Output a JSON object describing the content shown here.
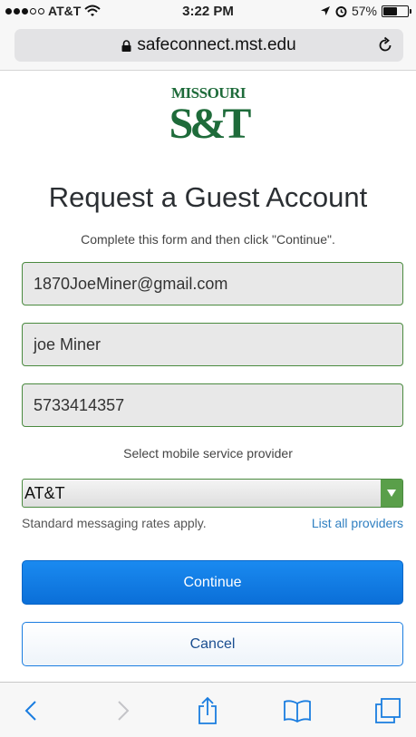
{
  "status_bar": {
    "carrier": "AT&T",
    "time": "3:22 PM",
    "battery": "57%",
    "battery_level": 0.57
  },
  "browser": {
    "url": "safeconnect.mst.edu"
  },
  "logo": {
    "top_text": "MISSOURI",
    "mark_text": "S&T"
  },
  "page": {
    "title": "Request a Guest Account",
    "instructions": "Complete this form and then click \"Continue\"."
  },
  "form": {
    "email_value": "1870JoeMiner@gmail.com",
    "name_value": "joe Miner",
    "phone_value": "5733414357",
    "provider_label": "Select mobile service provider",
    "provider_selected": "AT&T",
    "rates_note": "Standard messaging rates apply.",
    "list_providers_link": "List all providers",
    "continue_label": "Continue",
    "cancel_label": "Cancel"
  },
  "toolbar": {
    "icons": [
      "back-icon",
      "forward-icon",
      "share-icon",
      "bookmarks-icon",
      "tabs-icon"
    ]
  },
  "colors": {
    "accent": "#0b6fd8",
    "brand_green": "#1e6b3a",
    "field_border": "#4a8a3f",
    "link": "#2f7fc1"
  }
}
